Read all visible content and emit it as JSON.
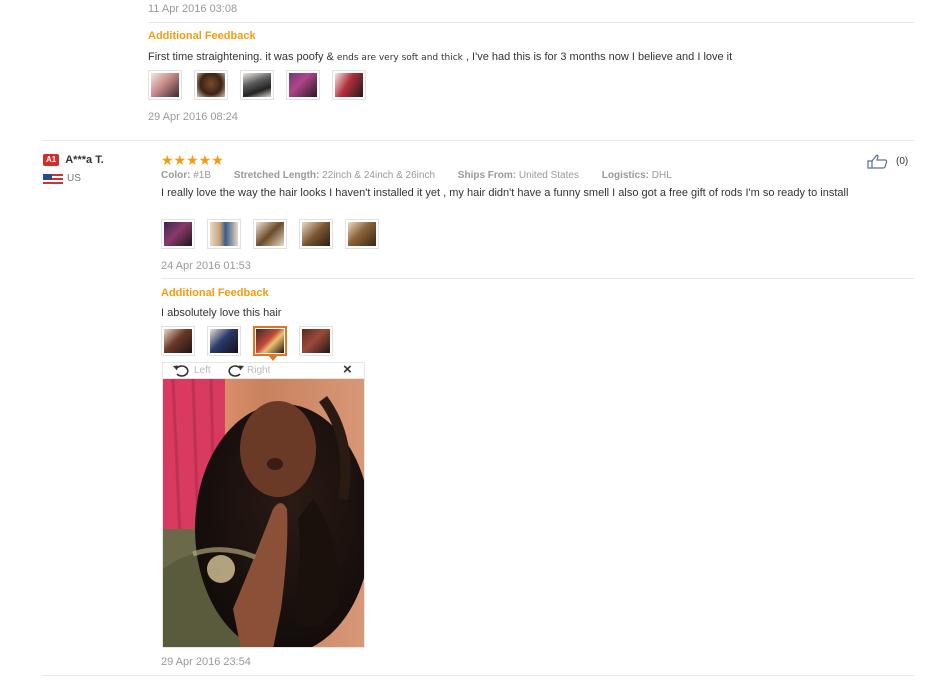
{
  "review1": {
    "date_top": "11 Apr 2016 03:08",
    "additional_feedback_title": "Additional Feedback",
    "feedback_text_a": "First time straightening. it was poofy &",
    "feedback_text_b": "ends are very soft and thick",
    "feedback_text_c": ", I've had this is for 3 months now I believe and I love it",
    "feedback_date": "29 Apr 2016 08:24"
  },
  "review2": {
    "reviewer_badge": "A1",
    "reviewer_name": "A***a T.",
    "country": "US",
    "stars": "★★★★★",
    "props": [
      {
        "label": "Color:",
        "value": "#1B"
      },
      {
        "label": "Stretched Length:",
        "value": "22inch & 24inch & 26inch"
      },
      {
        "label": "Ships From:",
        "value": "United States"
      },
      {
        "label": "Logistics:",
        "value": "DHL"
      }
    ],
    "helpful_count": "(0)",
    "text": "I really love the way the hair looks I haven't installed it yet , my hair didn't have a funny smell I also got a free gift of rods I'm so ready to install",
    "date": "24 Apr 2016 01:53",
    "additional_feedback_title": "Additional Feedback",
    "additional_text": "I absolutely love this hair",
    "viewer": {
      "rotate_left": "Left",
      "rotate_right": "Right",
      "close": "×"
    },
    "additional_date": "29 Apr 2016 23:54"
  },
  "colors": {
    "accent": "#f39c12",
    "selected_border": "#e0761e",
    "badge": "#d62b2b"
  }
}
